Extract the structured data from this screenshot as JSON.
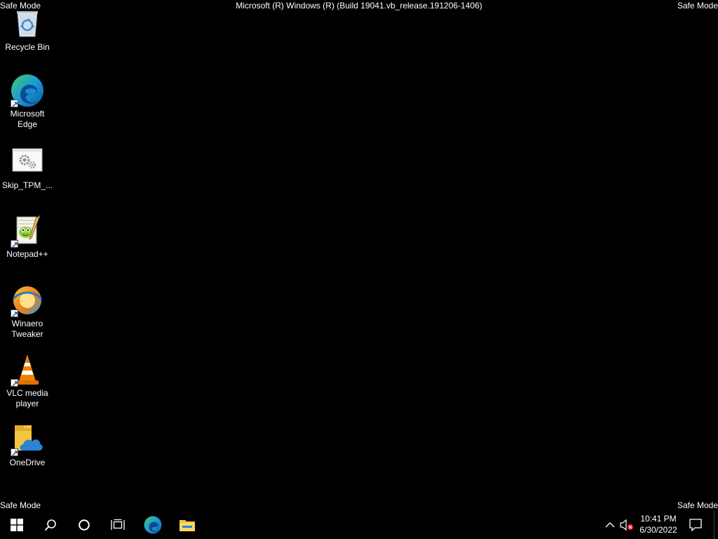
{
  "watermark": {
    "safe_mode": "Safe Mode",
    "build": "Microsoft (R) Windows (R) (Build 19041.vb_release.191206-1406)"
  },
  "desktop_icons": [
    {
      "label": "Recycle Bin",
      "icon": "recycle-bin-icon"
    },
    {
      "label": "Microsoft Edge",
      "icon": "edge-icon"
    },
    {
      "label": "Skip_TPM_...",
      "icon": "gears-icon"
    },
    {
      "label": "Notepad++",
      "icon": "notepad-plus-plus-icon"
    },
    {
      "label": "Winaero Tweaker",
      "icon": "winaero-tweaker-icon"
    },
    {
      "label": "VLC media player",
      "icon": "vlc-icon"
    },
    {
      "label": "OneDrive",
      "icon": "onedrive-icon"
    }
  ],
  "taskbar": {
    "buttons": [
      "start-icon",
      "search-icon",
      "cortana-icon",
      "task-view-icon",
      "edge-icon",
      "file-explorer-icon"
    ],
    "tray": {
      "time": "10:41 PM",
      "date": "6/30/2022",
      "icons": [
        "chevron-up-icon",
        "volume-muted-icon",
        "action-center-icon"
      ]
    }
  },
  "colors": {
    "background": "#000000",
    "text": "#ffffff",
    "edge_blue": "#1b8bd8",
    "edge_green": "#3fcf6a",
    "vlc_orange": "#f08000",
    "folder_yellow": "#f5c542",
    "onedrive_blue": "#2a84d2",
    "mute_red": "#e81123"
  }
}
